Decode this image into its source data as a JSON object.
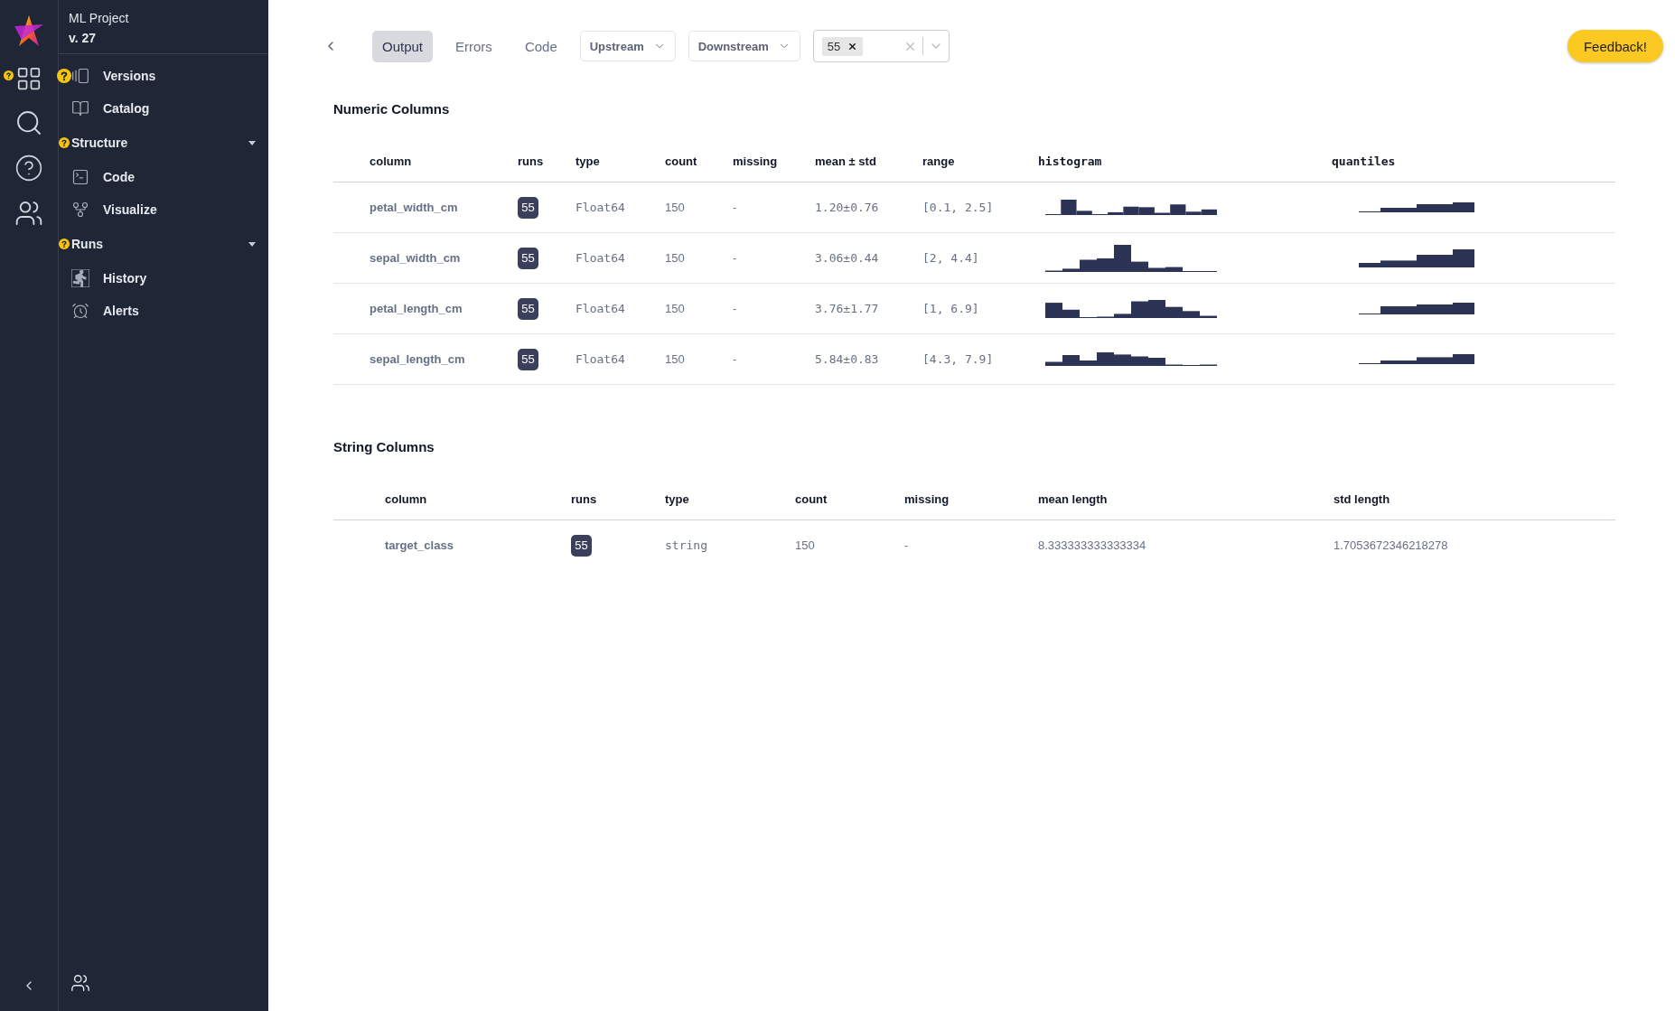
{
  "sidebar": {
    "project": "ML Project",
    "version": "v. 27",
    "items": [
      {
        "kind": "item",
        "label": "Versions",
        "help_badge": true
      },
      {
        "kind": "item",
        "label": "Catalog",
        "help_badge": false
      },
      {
        "kind": "section",
        "label": "Structure",
        "help_badge": true,
        "expanded": true,
        "children": [
          {
            "kind": "item",
            "label": "Code",
            "help_badge": false
          },
          {
            "kind": "item",
            "label": "Visualize",
            "help_badge": false
          }
        ]
      },
      {
        "kind": "section",
        "label": "Runs",
        "help_badge": true,
        "expanded": true,
        "children": [
          {
            "kind": "item",
            "label": "History",
            "help_badge": false
          },
          {
            "kind": "item",
            "label": "Alerts",
            "help_badge": false
          }
        ]
      }
    ]
  },
  "toolbar": {
    "tabs": [
      {
        "label": "Output",
        "selected": true
      },
      {
        "label": "Errors",
        "selected": false
      },
      {
        "label": "Code",
        "selected": false
      }
    ],
    "dropdowns": [
      "Upstream",
      "Downstream"
    ],
    "run_filter": {
      "chips": [
        "55"
      ]
    },
    "feedback": "Feedback!"
  },
  "numeric": {
    "title": "Numeric Columns",
    "columns": [
      "column",
      "runs",
      "type",
      "count",
      "missing",
      "mean ± std",
      "range",
      "histogram",
      "quantiles"
    ],
    "rows": [
      {
        "column": "petal_width_cm",
        "runs": "55",
        "type": "Float64",
        "count": "150",
        "missing": "-",
        "mean_std": "1.20±0.76",
        "range": "[0.1, 2.5]"
      },
      {
        "column": "sepal_width_cm",
        "runs": "55",
        "type": "Float64",
        "count": "150",
        "missing": "-",
        "mean_std": "3.06±0.44",
        "range": "[2, 4.4]"
      },
      {
        "column": "petal_length_cm",
        "runs": "55",
        "type": "Float64",
        "count": "150",
        "missing": "-",
        "mean_std": "3.76±1.77",
        "range": "[1, 6.9]"
      },
      {
        "column": "sepal_length_cm",
        "runs": "55",
        "type": "Float64",
        "count": "150",
        "missing": "-",
        "mean_std": "5.84±0.83",
        "range": "[4.3, 7.9]"
      }
    ]
  },
  "string": {
    "title": "String Columns",
    "columns": [
      "column",
      "runs",
      "type",
      "count",
      "missing",
      "mean length",
      "std length"
    ],
    "rows": [
      {
        "column": "target_class",
        "runs": "55",
        "type": "string",
        "count": "150",
        "missing": "-",
        "mean_length": "8.333333333333334",
        "std_length": "1.7053672346218278"
      }
    ]
  }
}
